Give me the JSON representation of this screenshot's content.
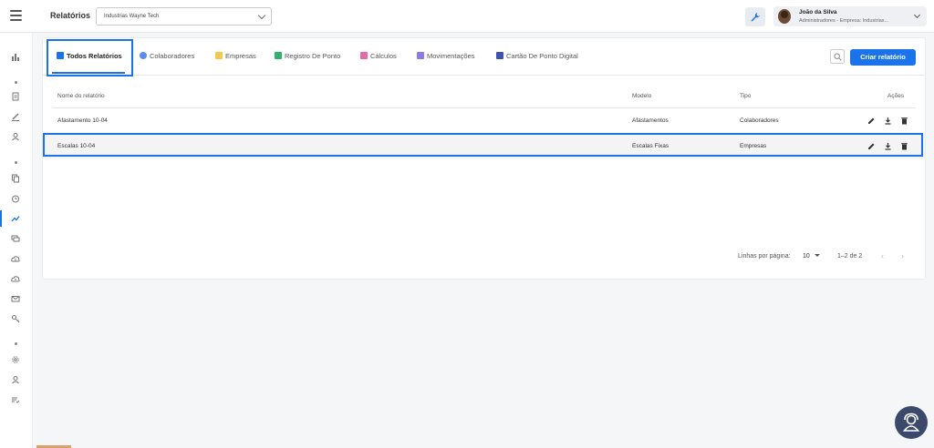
{
  "header": {
    "title": "Relatórios",
    "company_select": {
      "value": "Industrias Wayne Tech"
    },
    "user": {
      "name": "João da Silva",
      "subtitle": "Administradores - Empresa: Industrias..."
    }
  },
  "tabs": [
    {
      "label": "Todos Relatórios",
      "active": true,
      "icon": "report-icon",
      "color": "#1a73e8"
    },
    {
      "label": "Colaboradores",
      "active": false,
      "icon": "people-icon",
      "color": "#5b8def"
    },
    {
      "label": "Empresas",
      "active": false,
      "icon": "building-icon",
      "color": "#f2c94c"
    },
    {
      "label": "Registro De Ponto",
      "active": false,
      "icon": "clock-sheet-icon",
      "color": "#2fb36b"
    },
    {
      "label": "Cálculos",
      "active": false,
      "icon": "calculator-icon",
      "color": "#e46aa8"
    },
    {
      "label": "Movimentações",
      "active": false,
      "icon": "transfer-icon",
      "color": "#8a7be8"
    },
    {
      "label": "Cartão De Ponto Digital",
      "active": false,
      "icon": "digital-card-icon",
      "color": "#3f51b5"
    }
  ],
  "actions": {
    "create_label": "Criar relatório"
  },
  "table": {
    "columns": [
      "Nome do relatório",
      "Modelo",
      "Tipo",
      "Ações"
    ],
    "rows": [
      {
        "name": "Afastamento 10-04",
        "model": "Afastamentos",
        "type": "Colaboradores"
      },
      {
        "name": "Escalas 10-04",
        "model": "Escalas Fixas",
        "type": "Empresas"
      }
    ]
  },
  "pagination": {
    "rows_label": "Linhas por página:",
    "rows_value": "10",
    "range": "1–2 de 2"
  },
  "colors": {
    "accent": "#1a73e8",
    "fab": "#3b4a6b"
  }
}
